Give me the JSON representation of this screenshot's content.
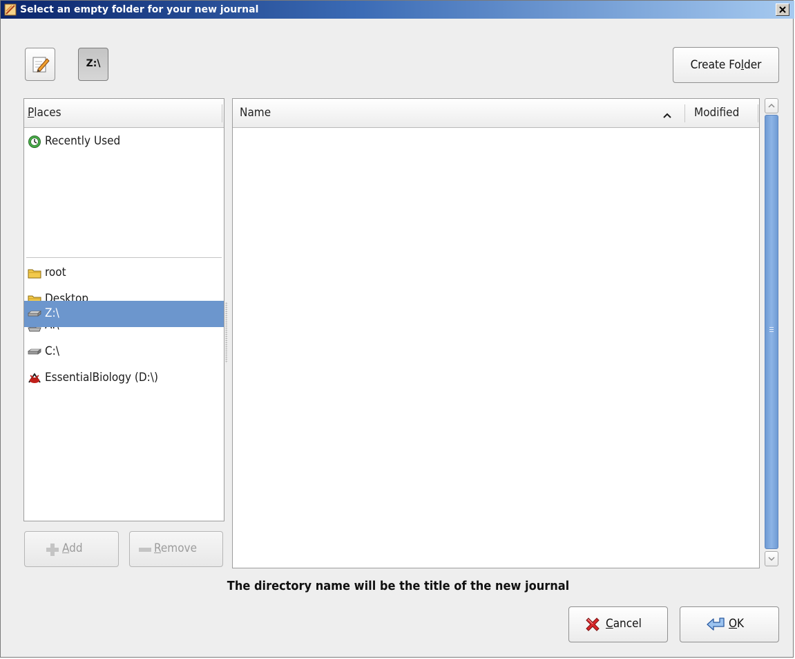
{
  "window": {
    "title": "Select an empty folder for your new journal"
  },
  "toolbar": {
    "path_button_label": "Z:\\",
    "create_folder": {
      "before": "Create Fo",
      "mnemonic": "l",
      "after": "der"
    }
  },
  "places": {
    "header": {
      "mnemonic": "P",
      "rest": "laces"
    },
    "items": [
      {
        "label": "Recently Used",
        "icon": "recently-used-icon"
      },
      {
        "label": "root",
        "icon": "folder-icon"
      },
      {
        "label": "Desktop",
        "icon": "folder-icon"
      },
      {
        "label": "A:\\",
        "icon": "floppy-drive-icon"
      },
      {
        "label": "C:\\",
        "icon": "hard-drive-icon"
      },
      {
        "label": "EssentialBiology (D:\\)",
        "icon": "cdrom-drive-icon"
      },
      {
        "label": "Z:\\",
        "icon": "hard-drive-icon",
        "selected": true
      }
    ],
    "add_button": {
      "mnemonic": "A",
      "rest": "dd"
    },
    "remove_button": {
      "mnemonic": "R",
      "rest": "emove"
    }
  },
  "files": {
    "columns": {
      "name": "Name",
      "modified": "Modified"
    },
    "sort": "ascending",
    "rows": []
  },
  "hint": "The directory name will be the title of the new journal",
  "buttons": {
    "cancel": {
      "mnemonic": "C",
      "rest": "ancel"
    },
    "ok": {
      "mnemonic": "O",
      "rest": "K"
    }
  },
  "colors": {
    "selection": "#6c96cd",
    "scroll_thumb": "#7aa4da",
    "title_gradient_start": "#0a246a",
    "title_gradient_end": "#a6caf0"
  }
}
